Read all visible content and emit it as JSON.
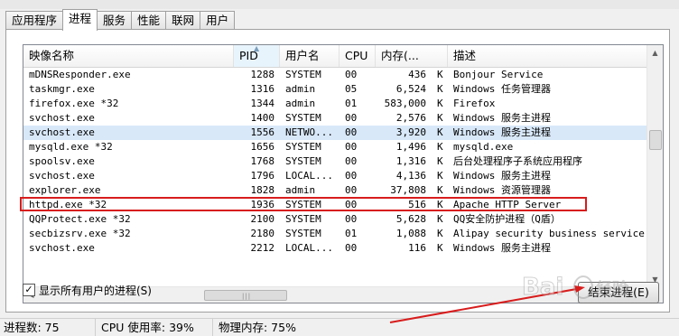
{
  "tabs": [
    "应用程序",
    "进程",
    "服务",
    "性能",
    "联网",
    "用户"
  ],
  "columns": [
    "映像名称",
    "PID",
    "用户名",
    "CPU",
    "内存(...",
    "描述"
  ],
  "sort_column": "PID",
  "rows": [
    {
      "name": "mDNSResponder.exe",
      "pid": "1288",
      "user": "SYSTEM",
      "cpu": "00",
      "mem": "436",
      "unit": "K",
      "desc": "Bonjour Service"
    },
    {
      "name": "taskmgr.exe",
      "pid": "1316",
      "user": "admin",
      "cpu": "05",
      "mem": "6,524",
      "unit": "K",
      "desc": "Windows 任务管理器"
    },
    {
      "name": "firefox.exe *32",
      "pid": "1344",
      "user": "admin",
      "cpu": "01",
      "mem": "583,000",
      "unit": "K",
      "desc": "Firefox"
    },
    {
      "name": "svchost.exe",
      "pid": "1400",
      "user": "SYSTEM",
      "cpu": "00",
      "mem": "2,576",
      "unit": "K",
      "desc": "Windows 服务主进程"
    },
    {
      "name": "svchost.exe",
      "pid": "1556",
      "user": "NETWO...",
      "cpu": "00",
      "mem": "3,920",
      "unit": "K",
      "desc": "Windows 服务主进程"
    },
    {
      "name": "mysqld.exe *32",
      "pid": "1656",
      "user": "SYSTEM",
      "cpu": "00",
      "mem": "1,496",
      "unit": "K",
      "desc": "mysqld.exe"
    },
    {
      "name": "spoolsv.exe",
      "pid": "1768",
      "user": "SYSTEM",
      "cpu": "00",
      "mem": "1,316",
      "unit": "K",
      "desc": "后台处理程序子系统应用程序"
    },
    {
      "name": "svchost.exe",
      "pid": "1796",
      "user": "LOCAL...",
      "cpu": "00",
      "mem": "4,136",
      "unit": "K",
      "desc": "Windows 服务主进程"
    },
    {
      "name": "explorer.exe",
      "pid": "1828",
      "user": "admin",
      "cpu": "00",
      "mem": "37,808",
      "unit": "K",
      "desc": "Windows 资源管理器"
    },
    {
      "name": "httpd.exe *32",
      "pid": "1936",
      "user": "SYSTEM",
      "cpu": "00",
      "mem": "516",
      "unit": "K",
      "desc": "Apache HTTP Server"
    },
    {
      "name": "QQProtect.exe *32",
      "pid": "2100",
      "user": "SYSTEM",
      "cpu": "00",
      "mem": "5,628",
      "unit": "K",
      "desc": "QQ安全防护进程（Q盾）"
    },
    {
      "name": "secbizsrv.exe *32",
      "pid": "2180",
      "user": "SYSTEM",
      "cpu": "01",
      "mem": "1,088",
      "unit": "K",
      "desc": "Alipay security business service"
    },
    {
      "name": "svchost.exe",
      "pid": "2212",
      "user": "LOCAL...",
      "cpu": "00",
      "mem": "116",
      "unit": "K",
      "desc": "Windows 服务主进程"
    }
  ],
  "show_all_users_label": "显示所有用户的进程(S)",
  "show_all_users_checked": true,
  "end_process_label": "结束进程(E)",
  "status": {
    "processes": "进程数: 75",
    "cpu": "CPU 使用率: 39%",
    "memory": "物理内存: 75%"
  },
  "colors": {
    "highlight_box": "#d81c1c",
    "selected_row": "#d8e8f8"
  },
  "icons": {
    "checkbox": "checkmark",
    "sort": "up-triangle"
  }
}
